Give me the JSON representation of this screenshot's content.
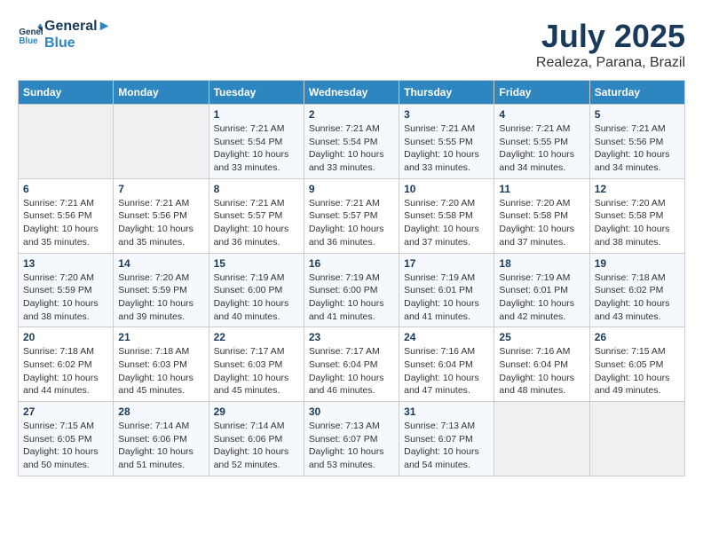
{
  "header": {
    "logo_line1": "General",
    "logo_line2": "Blue",
    "month_title": "July 2025",
    "location": "Realeza, Parana, Brazil"
  },
  "days_of_week": [
    "Sunday",
    "Monday",
    "Tuesday",
    "Wednesday",
    "Thursday",
    "Friday",
    "Saturday"
  ],
  "weeks": [
    [
      {
        "day": "",
        "detail": ""
      },
      {
        "day": "",
        "detail": ""
      },
      {
        "day": "1",
        "detail": "Sunrise: 7:21 AM\nSunset: 5:54 PM\nDaylight: 10 hours\nand 33 minutes."
      },
      {
        "day": "2",
        "detail": "Sunrise: 7:21 AM\nSunset: 5:54 PM\nDaylight: 10 hours\nand 33 minutes."
      },
      {
        "day": "3",
        "detail": "Sunrise: 7:21 AM\nSunset: 5:55 PM\nDaylight: 10 hours\nand 33 minutes."
      },
      {
        "day": "4",
        "detail": "Sunrise: 7:21 AM\nSunset: 5:55 PM\nDaylight: 10 hours\nand 34 minutes."
      },
      {
        "day": "5",
        "detail": "Sunrise: 7:21 AM\nSunset: 5:56 PM\nDaylight: 10 hours\nand 34 minutes."
      }
    ],
    [
      {
        "day": "6",
        "detail": "Sunrise: 7:21 AM\nSunset: 5:56 PM\nDaylight: 10 hours\nand 35 minutes."
      },
      {
        "day": "7",
        "detail": "Sunrise: 7:21 AM\nSunset: 5:56 PM\nDaylight: 10 hours\nand 35 minutes."
      },
      {
        "day": "8",
        "detail": "Sunrise: 7:21 AM\nSunset: 5:57 PM\nDaylight: 10 hours\nand 36 minutes."
      },
      {
        "day": "9",
        "detail": "Sunrise: 7:21 AM\nSunset: 5:57 PM\nDaylight: 10 hours\nand 36 minutes."
      },
      {
        "day": "10",
        "detail": "Sunrise: 7:20 AM\nSunset: 5:58 PM\nDaylight: 10 hours\nand 37 minutes."
      },
      {
        "day": "11",
        "detail": "Sunrise: 7:20 AM\nSunset: 5:58 PM\nDaylight: 10 hours\nand 37 minutes."
      },
      {
        "day": "12",
        "detail": "Sunrise: 7:20 AM\nSunset: 5:58 PM\nDaylight: 10 hours\nand 38 minutes."
      }
    ],
    [
      {
        "day": "13",
        "detail": "Sunrise: 7:20 AM\nSunset: 5:59 PM\nDaylight: 10 hours\nand 38 minutes."
      },
      {
        "day": "14",
        "detail": "Sunrise: 7:20 AM\nSunset: 5:59 PM\nDaylight: 10 hours\nand 39 minutes."
      },
      {
        "day": "15",
        "detail": "Sunrise: 7:19 AM\nSunset: 6:00 PM\nDaylight: 10 hours\nand 40 minutes."
      },
      {
        "day": "16",
        "detail": "Sunrise: 7:19 AM\nSunset: 6:00 PM\nDaylight: 10 hours\nand 41 minutes."
      },
      {
        "day": "17",
        "detail": "Sunrise: 7:19 AM\nSunset: 6:01 PM\nDaylight: 10 hours\nand 41 minutes."
      },
      {
        "day": "18",
        "detail": "Sunrise: 7:19 AM\nSunset: 6:01 PM\nDaylight: 10 hours\nand 42 minutes."
      },
      {
        "day": "19",
        "detail": "Sunrise: 7:18 AM\nSunset: 6:02 PM\nDaylight: 10 hours\nand 43 minutes."
      }
    ],
    [
      {
        "day": "20",
        "detail": "Sunrise: 7:18 AM\nSunset: 6:02 PM\nDaylight: 10 hours\nand 44 minutes."
      },
      {
        "day": "21",
        "detail": "Sunrise: 7:18 AM\nSunset: 6:03 PM\nDaylight: 10 hours\nand 45 minutes."
      },
      {
        "day": "22",
        "detail": "Sunrise: 7:17 AM\nSunset: 6:03 PM\nDaylight: 10 hours\nand 45 minutes."
      },
      {
        "day": "23",
        "detail": "Sunrise: 7:17 AM\nSunset: 6:04 PM\nDaylight: 10 hours\nand 46 minutes."
      },
      {
        "day": "24",
        "detail": "Sunrise: 7:16 AM\nSunset: 6:04 PM\nDaylight: 10 hours\nand 47 minutes."
      },
      {
        "day": "25",
        "detail": "Sunrise: 7:16 AM\nSunset: 6:04 PM\nDaylight: 10 hours\nand 48 minutes."
      },
      {
        "day": "26",
        "detail": "Sunrise: 7:15 AM\nSunset: 6:05 PM\nDaylight: 10 hours\nand 49 minutes."
      }
    ],
    [
      {
        "day": "27",
        "detail": "Sunrise: 7:15 AM\nSunset: 6:05 PM\nDaylight: 10 hours\nand 50 minutes."
      },
      {
        "day": "28",
        "detail": "Sunrise: 7:14 AM\nSunset: 6:06 PM\nDaylight: 10 hours\nand 51 minutes."
      },
      {
        "day": "29",
        "detail": "Sunrise: 7:14 AM\nSunset: 6:06 PM\nDaylight: 10 hours\nand 52 minutes."
      },
      {
        "day": "30",
        "detail": "Sunrise: 7:13 AM\nSunset: 6:07 PM\nDaylight: 10 hours\nand 53 minutes."
      },
      {
        "day": "31",
        "detail": "Sunrise: 7:13 AM\nSunset: 6:07 PM\nDaylight: 10 hours\nand 54 minutes."
      },
      {
        "day": "",
        "detail": ""
      },
      {
        "day": "",
        "detail": ""
      }
    ]
  ]
}
